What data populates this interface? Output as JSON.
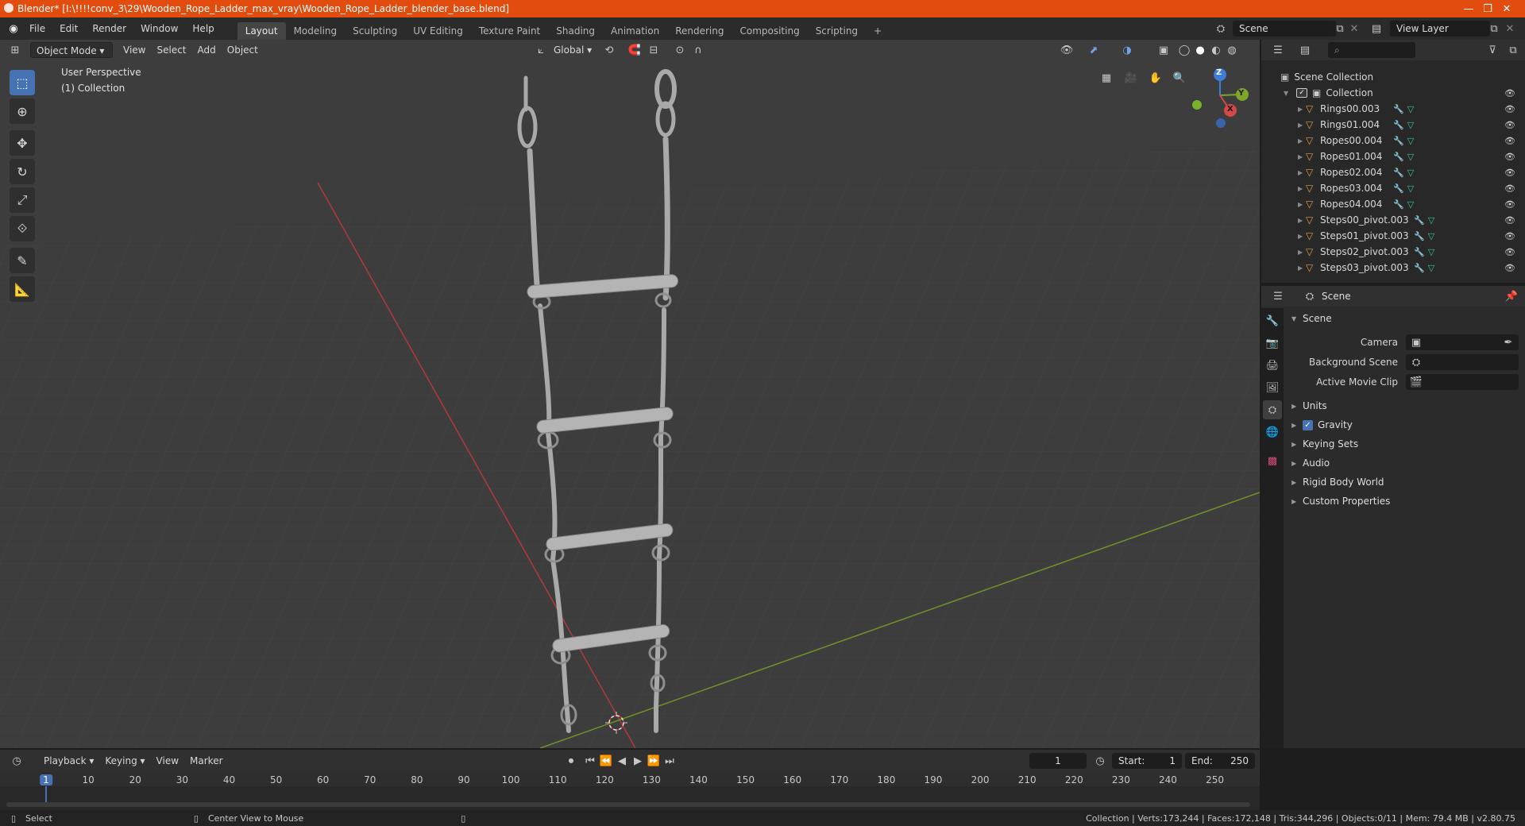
{
  "window": {
    "title": "Blender* [I:\\!!!!conv_3\\29\\Wooden_Rope_Ladder_max_vray\\Wooden_Rope_Ladder_blender_base.blend]",
    "minimize": "—",
    "maximize": "❐",
    "close": "✕"
  },
  "menu": [
    "File",
    "Edit",
    "Render",
    "Window",
    "Help"
  ],
  "workspaces": [
    "Layout",
    "Modeling",
    "Sculpting",
    "UV Editing",
    "Texture Paint",
    "Shading",
    "Animation",
    "Rendering",
    "Compositing",
    "Scripting"
  ],
  "active_workspace": "Layout",
  "add_workspace": "+",
  "scene_field": "Scene",
  "view_layer_field": "View Layer",
  "viewport_header": {
    "mode": "Object Mode",
    "menus": [
      "View",
      "Select",
      "Add",
      "Object"
    ],
    "transform_orientation": "Global"
  },
  "viewport_overlay": {
    "perspective": "User Perspective",
    "collection": "(1) Collection"
  },
  "gizmo": {
    "z": "Z",
    "y": "Y",
    "x": "X"
  },
  "outliner": {
    "scene_collection": "Scene Collection",
    "collection": "Collection",
    "objects": [
      "Rings00.003",
      "Rings01.004",
      "Ropes00.004",
      "Ropes01.004",
      "Ropes02.004",
      "Ropes03.004",
      "Ropes04.004",
      "Steps00_pivot.003",
      "Steps01_pivot.003",
      "Steps02_pivot.003",
      "Steps03_pivot.003"
    ]
  },
  "properties": {
    "header": "Scene",
    "panel": "Scene",
    "camera_label": "Camera",
    "background_scene_label": "Background Scene",
    "active_movie_clip_label": "Active Movie Clip",
    "sections": [
      "Units",
      "Gravity",
      "Keying Sets",
      "Audio",
      "Rigid Body World",
      "Custom Properties"
    ],
    "gravity_enabled": true
  },
  "timeline": {
    "menus": [
      "Playback",
      "Keying",
      "View",
      "Marker"
    ],
    "current_frame": "1",
    "start_label": "Start:",
    "start": "1",
    "end_label": "End:",
    "end": "250",
    "ruler": [
      "1",
      "10",
      "20",
      "30",
      "40",
      "50",
      "60",
      "70",
      "80",
      "90",
      "100",
      "110",
      "120",
      "130",
      "140",
      "150",
      "160",
      "170",
      "180",
      "190",
      "200",
      "210",
      "220",
      "230",
      "240",
      "250"
    ]
  },
  "statusbar": {
    "select": "Select",
    "center_view": "Center View to Mouse",
    "stats": "Collection | Verts:173,244 | Faces:172,148 | Tris:344,296 | Objects:0/11 | Mem: 79.4 MB | v2.80.75"
  },
  "colors": {
    "title_bar": "#e24c0e",
    "accent": "#4772b3",
    "x_axis": "#c03a3a",
    "y_axis": "#7fa52c"
  }
}
